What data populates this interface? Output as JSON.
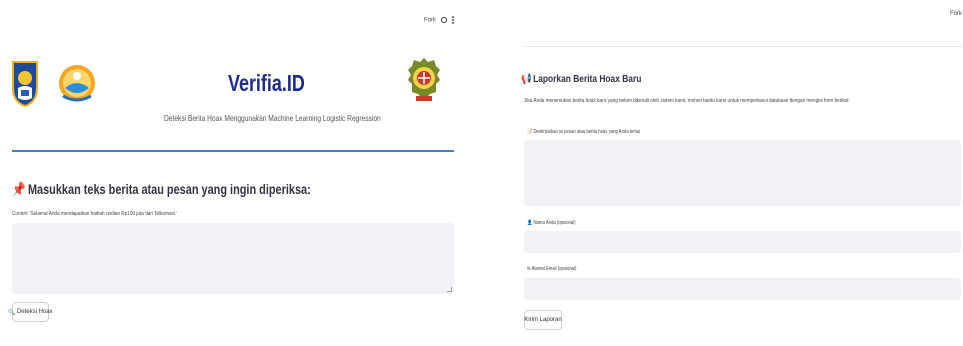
{
  "left": {
    "header": {
      "fork_label": "Fork"
    },
    "title": "Verifia.ID",
    "subtitle": "Deteksi Berita Hoax Menggunakan Machine Learning Logistic Regression",
    "section_title": "Masukkan teks berita atau pesan yang ingin diperiksa:",
    "example_text": "Contoh: 'Selamat Anda mendapatkan hadiah undian Rp100 juta dari Telkomsel.'",
    "textarea_value": "",
    "detect_button_label": "Deteksi Hoax"
  },
  "right": {
    "header": {
      "fork_label": "Fork"
    },
    "section_title": "Laporkan Berita Hoax Baru",
    "description": "Jika Anda menemukan berita hoax baru yang belum dikenali oleh sistem kami, mohon bantu kami untuk memperbarui database dengan mengisi form berikut:",
    "desc_label": "Deskripsikan isi pesan atau berita hoax yang Anda temui",
    "name_label": "Nama Anda (opsional)",
    "email_label": "Alamat Email (opsional)",
    "submit_label": "Kirim Laporan"
  },
  "colors": {
    "title": "#1e2a8c",
    "accent_line": "#3b7ddd",
    "input_bg": "#f0f2f6"
  }
}
